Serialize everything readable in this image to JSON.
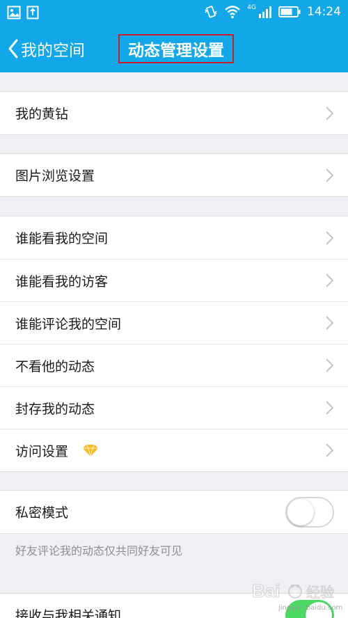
{
  "status_bar": {
    "time": "14:24",
    "network": "4G",
    "icons": [
      "gallery-icon",
      "notification-icon",
      "vibrate-icon",
      "wifi-icon",
      "signal-icon",
      "battery-icon"
    ]
  },
  "nav": {
    "back_label": "我的空间",
    "title": "动态管理设置"
  },
  "sections": [
    {
      "items": [
        {
          "label": "我的黄钻"
        }
      ]
    },
    {
      "items": [
        {
          "label": "图片浏览设置"
        }
      ]
    },
    {
      "items": [
        {
          "label": "谁能看我的空间"
        },
        {
          "label": "谁能看我的访客"
        },
        {
          "label": "谁能评论我的空间"
        },
        {
          "label": "不看他的动态"
        },
        {
          "label": "封存我的动态"
        },
        {
          "label": "访问设置",
          "badge_icon": "diamond-icon"
        }
      ]
    },
    {
      "items": [
        {
          "label": "私密模式",
          "toggle": false
        }
      ]
    },
    {
      "items": [
        {
          "label": "接收与我相关通知",
          "toggle": true
        }
      ]
    }
  ],
  "private_mode_hint": "好友评论我的动态仅共同好友可见",
  "watermark": {
    "brand": "Bai",
    "suffix": "经验",
    "url": "jingyan.baidu.com"
  },
  "colors": {
    "accent": "#12a7e8",
    "highlight_border": "#c8202b",
    "toggle_on": "#4cd964",
    "diamond": "#f5b922"
  }
}
